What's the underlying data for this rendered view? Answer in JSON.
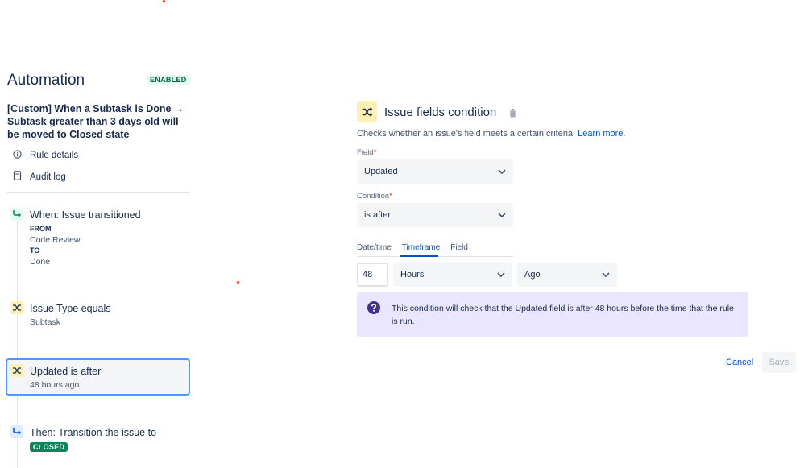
{
  "sidebar": {
    "title": "Automation",
    "status_badge": "ENABLED",
    "rule_name": "[Custom] When a Subtask is Done → Subtask greater than 3 days old will be moved to Closed state",
    "nav": [
      {
        "label": "Rule details",
        "icon": "info-icon"
      },
      {
        "label": "Audit log",
        "icon": "document-icon"
      }
    ],
    "nodes": {
      "trigger": {
        "title": "When: Issue transitioned",
        "from_label": "FROM",
        "from_value": "Code Review",
        "to_label": "TO",
        "to_value": "Done"
      },
      "condition1": {
        "title": "Issue Type equals",
        "sub": "Subtask"
      },
      "condition2": {
        "title": "Updated is after",
        "sub": "48 hours ago"
      },
      "action": {
        "title": "Then: Transition the issue to",
        "badge": "CLOSED"
      }
    }
  },
  "panel": {
    "title": "Issue fields condition",
    "description": "Checks whether an issue's field meets a certain criteria.",
    "learn_more": "Learn more.",
    "field_label": "Field",
    "field_value": "Updated",
    "condition_label": "Condition",
    "condition_value": "is after",
    "tabs": [
      "Date/time",
      "Timeframe",
      "Field"
    ],
    "active_tab": "Timeframe",
    "amount": "48",
    "unit": "Hours",
    "direction": "Ago",
    "info_text": "This condition will check that the Updated field is after 48 hours before the time that the rule is run.",
    "cancel_label": "Cancel",
    "save_label": "Save"
  },
  "colors": {
    "accent": "#0052cc",
    "enabled_green": "#006644",
    "closed_green": "#00875a",
    "selected_border": "#4c9aff",
    "info_bg": "#eae6ff"
  }
}
